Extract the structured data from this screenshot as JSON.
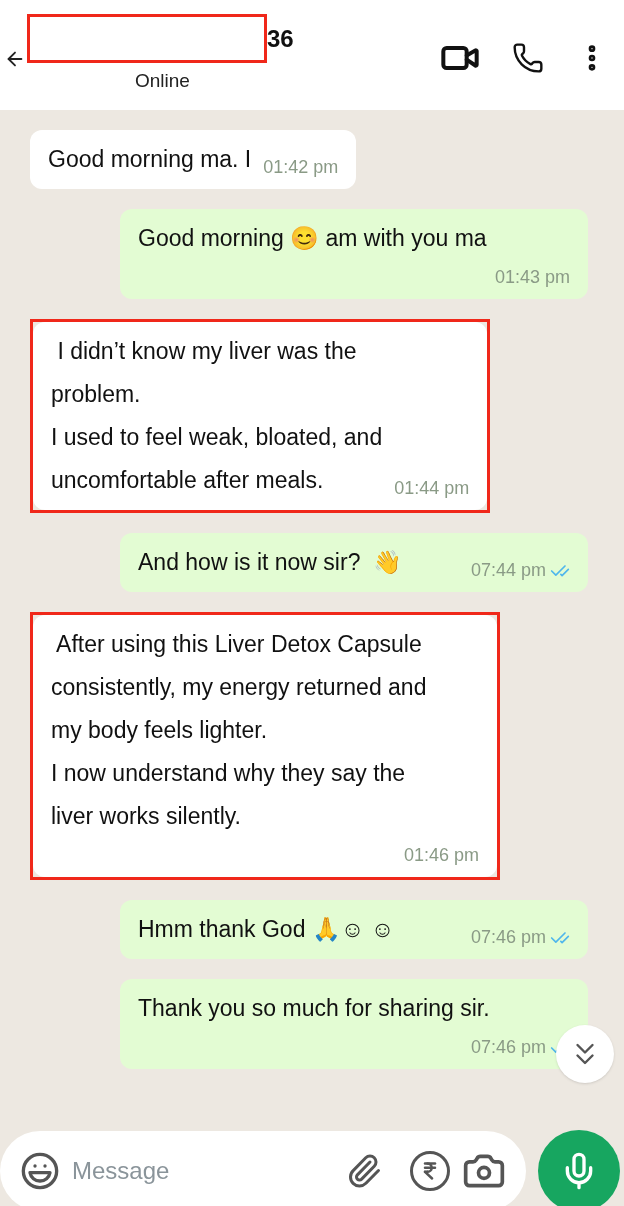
{
  "header": {
    "title": "36",
    "status": "Online"
  },
  "messages": [
    {
      "kind": "incoming",
      "highlighted": false,
      "lines": [
        "Good morning ma. I"
      ],
      "time": "01:42 pm"
    },
    {
      "kind": "outgoing",
      "read": false,
      "lines": [
        "Good morning 😊 am with you ma"
      ],
      "time": "01:43 pm"
    },
    {
      "kind": "incoming",
      "highlighted": true,
      "lines": [
        " I didn’t know my liver was the",
        "problem.",
        "I used to feel weak, bloated, and",
        "uncomfortable after meals."
      ],
      "time": "01:44 pm"
    },
    {
      "kind": "outgoing",
      "read": true,
      "lines": [
        "And how is it now sir?  👋"
      ],
      "time": "07:44 pm"
    },
    {
      "kind": "incoming",
      "highlighted": true,
      "lines": [
        " After using this Liver Detox Capsule",
        "consistently, my energy returned and",
        "my body feels lighter.",
        "I now understand why they say the",
        "liver works silently."
      ],
      "time": "01:46 pm"
    },
    {
      "kind": "outgoing",
      "read": true,
      "lines": [
        "Hmm thank God 🙏☺ ☺"
      ],
      "time": "07:46 pm"
    },
    {
      "kind": "outgoing",
      "read": true,
      "lines": [
        "Thank you so much for sharing sir."
      ],
      "time": "07:46 pm"
    }
  ],
  "composer": {
    "placeholder": "Message"
  }
}
